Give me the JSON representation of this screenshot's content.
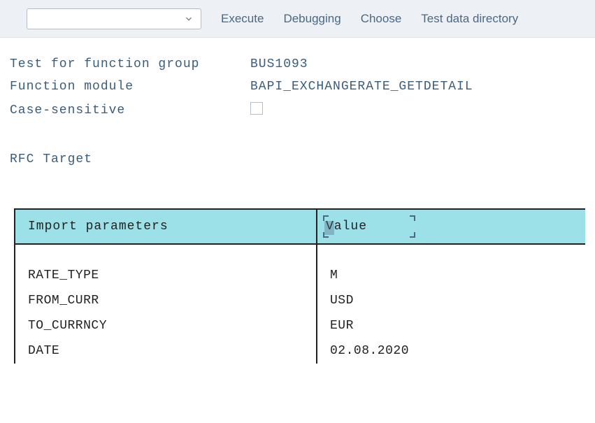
{
  "toolbar": {
    "dropdown_value": "",
    "links": {
      "execute": "Execute",
      "debugging": "Debugging",
      "choose": "Choose",
      "test_data_directory": "Test data directory"
    }
  },
  "info": {
    "test_for_function_group_label": "Test for function group",
    "test_for_function_group_value": "BUS1093",
    "function_module_label": "Function module",
    "function_module_value": "BAPI_EXCHANGERATE_GETDETAIL",
    "case_sensitive_label": "Case-sensitive"
  },
  "rfc_target_label": "RFC Target",
  "table": {
    "headers": {
      "import_parameters": "Import parameters",
      "value": "Value"
    },
    "rows": [
      {
        "param": "RATE_TYPE",
        "value": "M"
      },
      {
        "param": "FROM_CURR",
        "value": "USD"
      },
      {
        "param": "TO_CURRNCY",
        "value": "EUR"
      },
      {
        "param": "DATE",
        "value": "02.08.2020"
      }
    ]
  }
}
